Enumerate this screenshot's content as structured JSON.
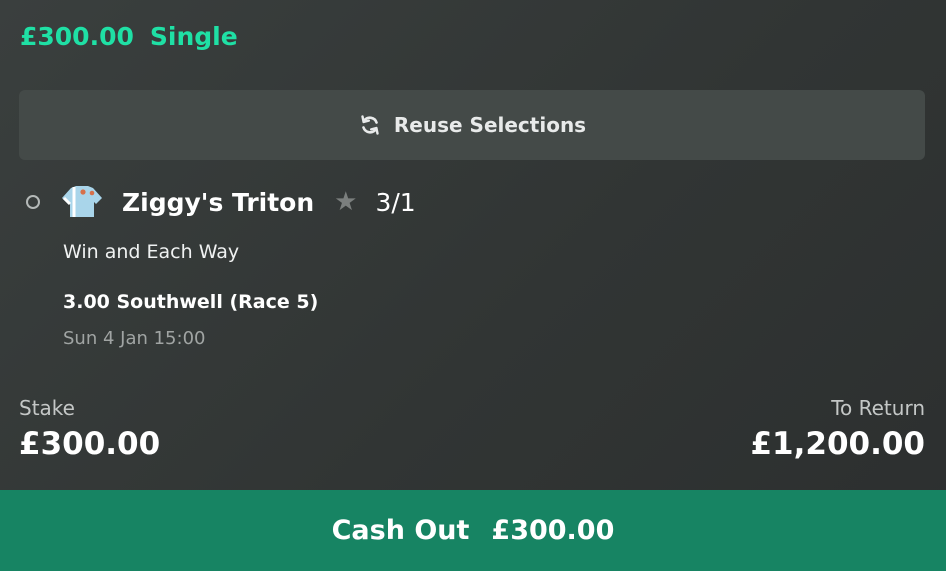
{
  "bet": {
    "amount": "£300.00",
    "type": "Single"
  },
  "reuse": {
    "label": "Reuse Selections",
    "icon": "refresh-icon"
  },
  "selection": {
    "runner": "Ziggy's Triton",
    "odds": "3/1",
    "market": "Win and Each Way",
    "event": "3.00 Southwell (Race 5)",
    "datetime": "Sun 4 Jan 15:00",
    "icons": [
      "radio-circle-icon",
      "jockey-silks-icon",
      "star-icon"
    ]
  },
  "summary": {
    "stake_label": "Stake",
    "stake_value": "£300.00",
    "return_label": "To Return",
    "return_value": "£1,200.00"
  },
  "cashout": {
    "label": "Cash Out",
    "value": "£300.00"
  },
  "colors": {
    "accent": "#1fe0a5",
    "cashout_bg": "#178463",
    "panel_bg": "#353938",
    "button_bg": "#444a48"
  }
}
